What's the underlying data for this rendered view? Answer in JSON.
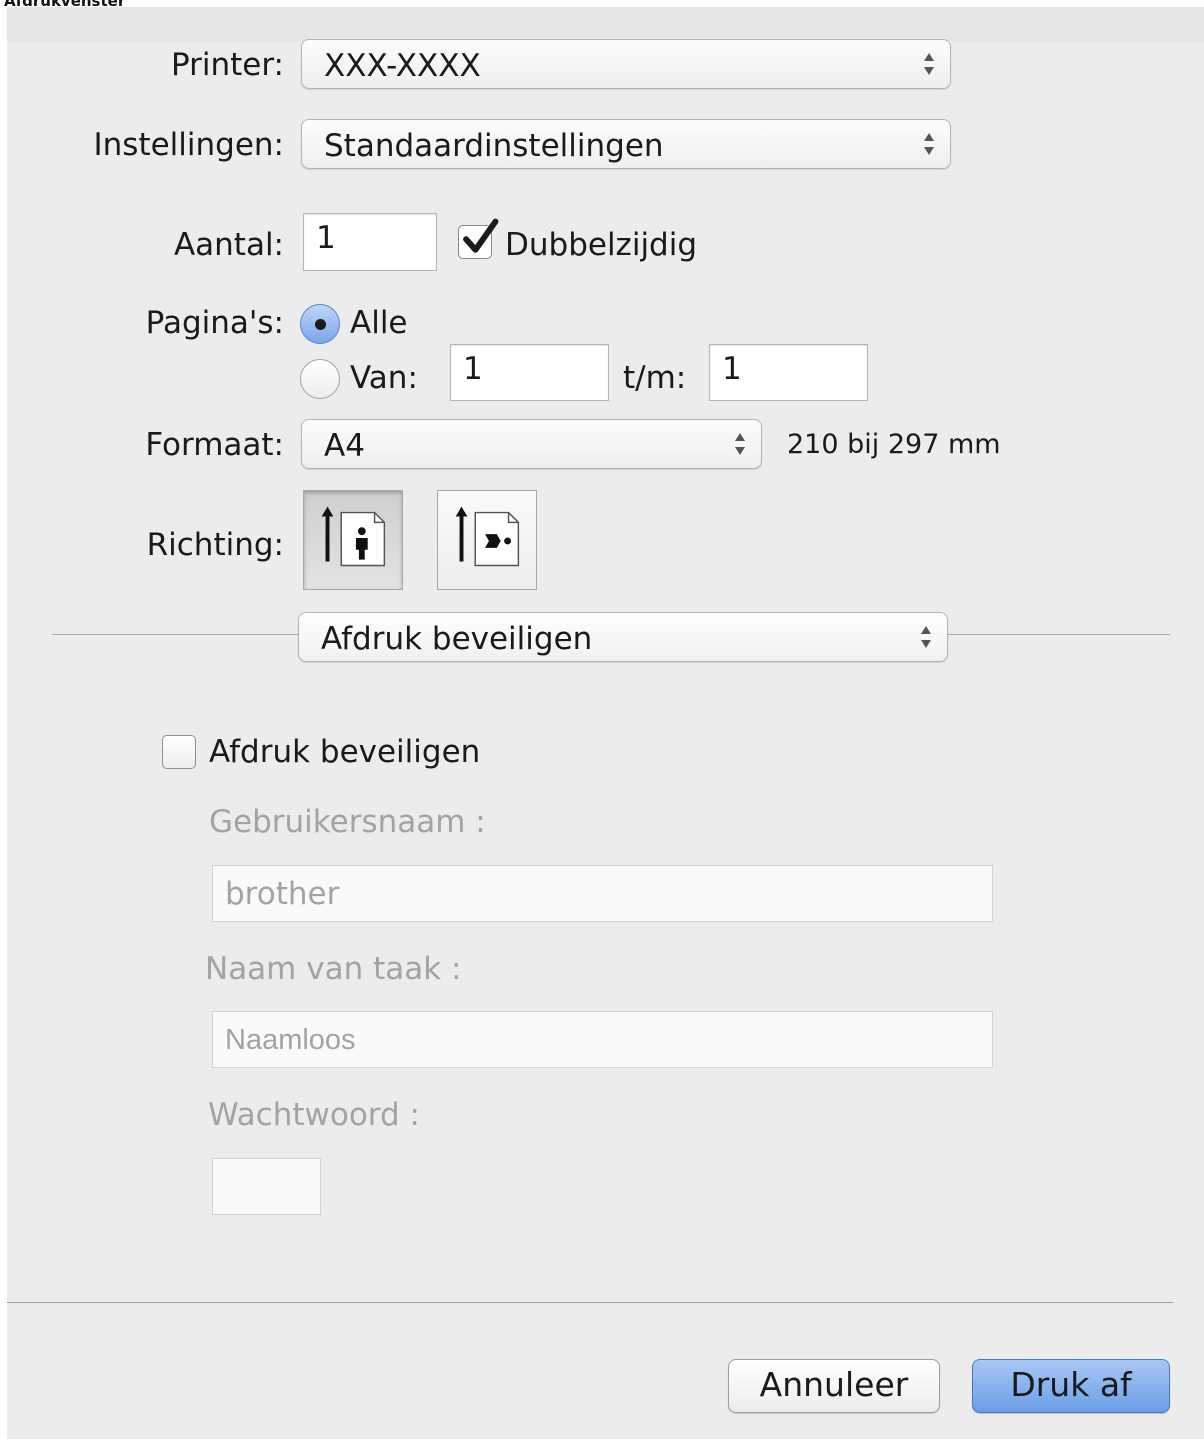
{
  "window": {
    "title_fragment": "Afdrukvenster"
  },
  "printer": {
    "label": "Printer:",
    "value": "XXX-XXXX"
  },
  "presets": {
    "label": "Instellingen:",
    "value": "Standaardinstellingen"
  },
  "copies": {
    "label": "Aantal:",
    "value": "1",
    "two_sided_label": "Dubbelzijdig",
    "two_sided_checked": true
  },
  "pages": {
    "label": "Pagina's:",
    "all_label": "Alle",
    "range_label": "Van:",
    "from": "1",
    "to_label": "t/m:",
    "to": "1",
    "selected": "all"
  },
  "paper": {
    "label": "Formaat:",
    "value": "A4",
    "dimensions": "210 bij 297 mm"
  },
  "orientation": {
    "label": "Richting:",
    "selected": "portrait",
    "options": [
      "portrait-icon",
      "landscape-icon"
    ]
  },
  "section": {
    "value": "Afdruk beveiligen"
  },
  "secure": {
    "checkbox_label": "Afdruk beveiligen",
    "checked": false,
    "username_label": "Gebruikersnaam :",
    "username_value": "brother",
    "jobname_label": "Naam van taak :",
    "jobname_value": "Naamloos",
    "password_label": "Wachtwoord :",
    "password_value": ""
  },
  "buttons": {
    "cancel": "Annuleer",
    "print": "Druk af"
  },
  "colors": {
    "accent": "#2f6dd8",
    "default_button": "#6a9ee6",
    "disabled_text": "#a3a3a3"
  }
}
